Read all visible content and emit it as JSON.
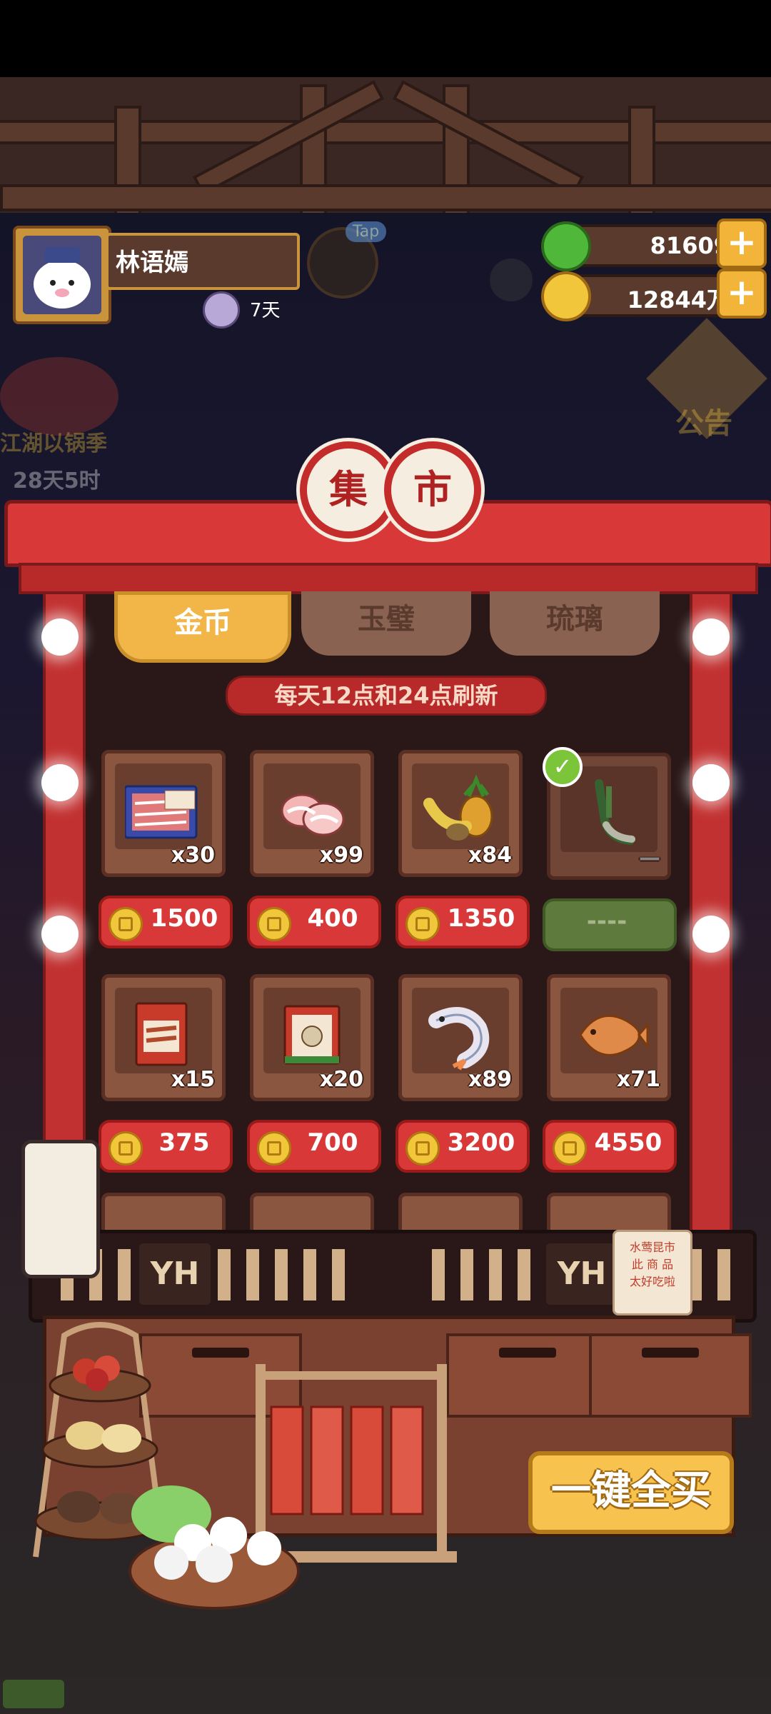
{
  "player": {
    "name": "林语嫣",
    "buff_days": "7天"
  },
  "hud": {
    "tap_label": "Tap",
    "event_name": "江湖以锅季",
    "event_timer": "28天5时",
    "notice_label": "公告"
  },
  "currencies": [
    {
      "name": "jade-apple",
      "value": "81609",
      "color": "#4fb83a"
    },
    {
      "name": "gold-coin",
      "value": "12844万",
      "color": "#f2c63a"
    }
  ],
  "stall": {
    "title_chars": [
      "集",
      "市"
    ],
    "tabs": [
      {
        "label": "金币",
        "active": true
      },
      {
        "label": "玉璧",
        "active": false
      },
      {
        "label": "琉璃",
        "active": false
      }
    ],
    "refresh_notice": "每天12点和24点刷新",
    "items": [
      {
        "name": "beef-pack",
        "qty": "x30",
        "price": "1500",
        "sold": false
      },
      {
        "name": "pork-slices",
        "qty": "x99",
        "price": "400",
        "sold": false
      },
      {
        "name": "fruit-bundle",
        "qty": "x84",
        "price": "1350",
        "sold": false
      },
      {
        "name": "green-onion",
        "qty": "",
        "price": "----",
        "sold": true
      },
      {
        "name": "meat-pack",
        "qty": "x15",
        "price": "375",
        "sold": false
      },
      {
        "name": "gongwan-bag",
        "qty": "x20",
        "price": "700",
        "sold": false
      },
      {
        "name": "shrimp",
        "qty": "x89",
        "price": "3200",
        "sold": false
      },
      {
        "name": "fish-cake",
        "qty": "x71",
        "price": "4550",
        "sold": false
      }
    ],
    "counter_sign": "YH",
    "notice_sign": [
      "水莺昆市",
      "此 商 品",
      "太好吃啦"
    ],
    "buy_all": "一键全买"
  }
}
